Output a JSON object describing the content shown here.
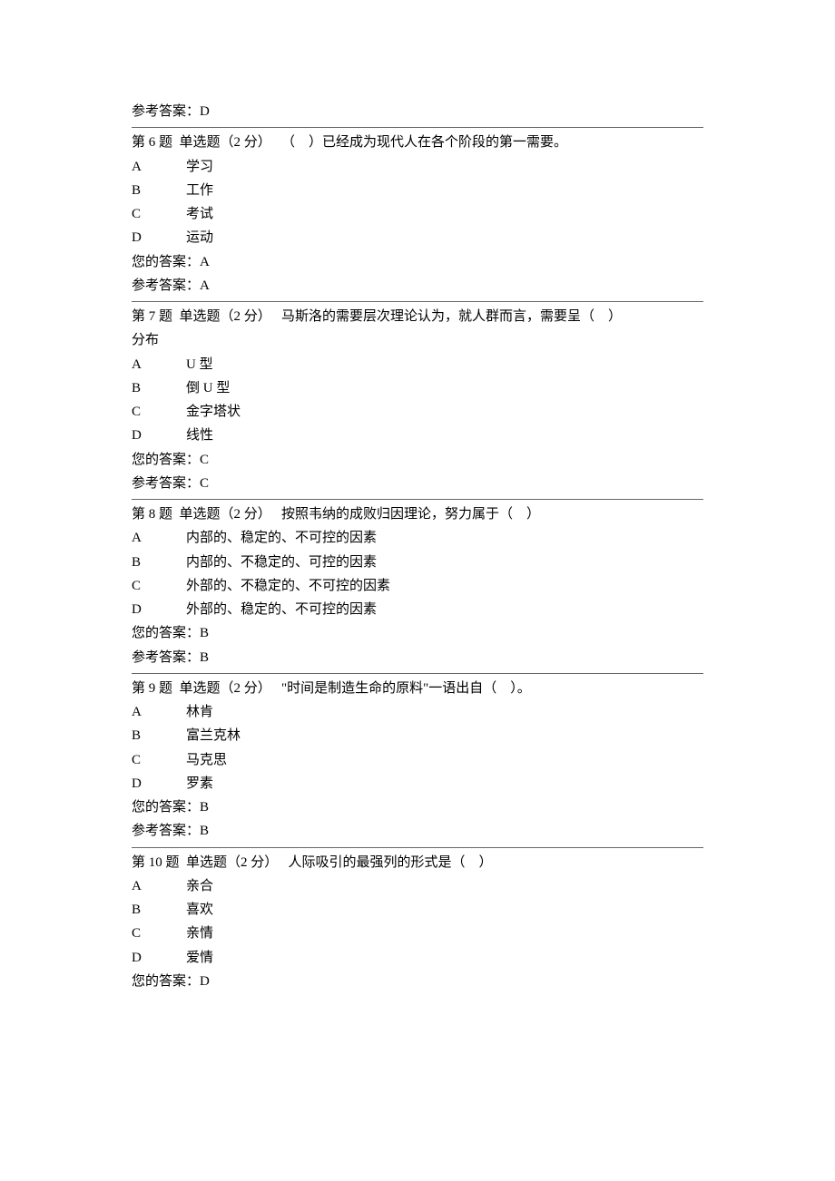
{
  "intro_answer": "参考答案：D",
  "questions": [
    {
      "number": "第 6 题",
      "type": "单选题（2 分）",
      "prompt": "（　）已经成为现代人在各个阶段的第一需要。",
      "continuation": "",
      "options": [
        {
          "letter": "A",
          "text": "学习"
        },
        {
          "letter": "B",
          "text": "工作"
        },
        {
          "letter": "C",
          "text": "考试"
        },
        {
          "letter": "D",
          "text": "运动"
        }
      ],
      "your_answer": "您的答案：A",
      "ref_answer": "参考答案：A"
    },
    {
      "number": "第 7 题",
      "type": "单选题（2 分）",
      "prompt": "马斯洛的需要层次理论认为，就人群而言，需要呈（　）",
      "continuation": "分布",
      "options": [
        {
          "letter": "A",
          "text": "U 型"
        },
        {
          "letter": "B",
          "text": "倒 U 型"
        },
        {
          "letter": "C",
          "text": "金字塔状"
        },
        {
          "letter": "D",
          "text": "线性"
        }
      ],
      "your_answer": "您的答案：C",
      "ref_answer": "参考答案：C"
    },
    {
      "number": "第 8 题",
      "type": "单选题（2 分）",
      "prompt": "按照韦纳的成败归因理论，努力属于（　）",
      "continuation": "",
      "options": [
        {
          "letter": "A",
          "text": "内部的、稳定的、不可控的因素"
        },
        {
          "letter": "B",
          "text": "内部的、不稳定的、可控的因素"
        },
        {
          "letter": "C",
          "text": "外部的、不稳定的、不可控的因素"
        },
        {
          "letter": "D",
          "text": "外部的、稳定的、不可控的因素"
        }
      ],
      "your_answer": "您的答案：B",
      "ref_answer": "参考答案：B"
    },
    {
      "number": "第 9 题",
      "type": "单选题（2 分）",
      "prompt": "\"时间是制造生命的原料\"一语出自（　）。",
      "continuation": "",
      "options": [
        {
          "letter": "A",
          "text": "林肯"
        },
        {
          "letter": "B",
          "text": "富兰克林"
        },
        {
          "letter": "C",
          "text": "马克思"
        },
        {
          "letter": "D",
          "text": "罗素"
        }
      ],
      "your_answer": "您的答案：B",
      "ref_answer": "参考答案：B"
    },
    {
      "number": "第 10 题",
      "type": "单选题（2 分）",
      "prompt": "人际吸引的最强列的形式是（　）",
      "continuation": "",
      "options": [
        {
          "letter": "A",
          "text": "亲合"
        },
        {
          "letter": "B",
          "text": "喜欢"
        },
        {
          "letter": "C",
          "text": "亲情"
        },
        {
          "letter": "D",
          "text": "爱情"
        }
      ],
      "your_answer": "您的答案：D",
      "ref_answer": ""
    }
  ]
}
